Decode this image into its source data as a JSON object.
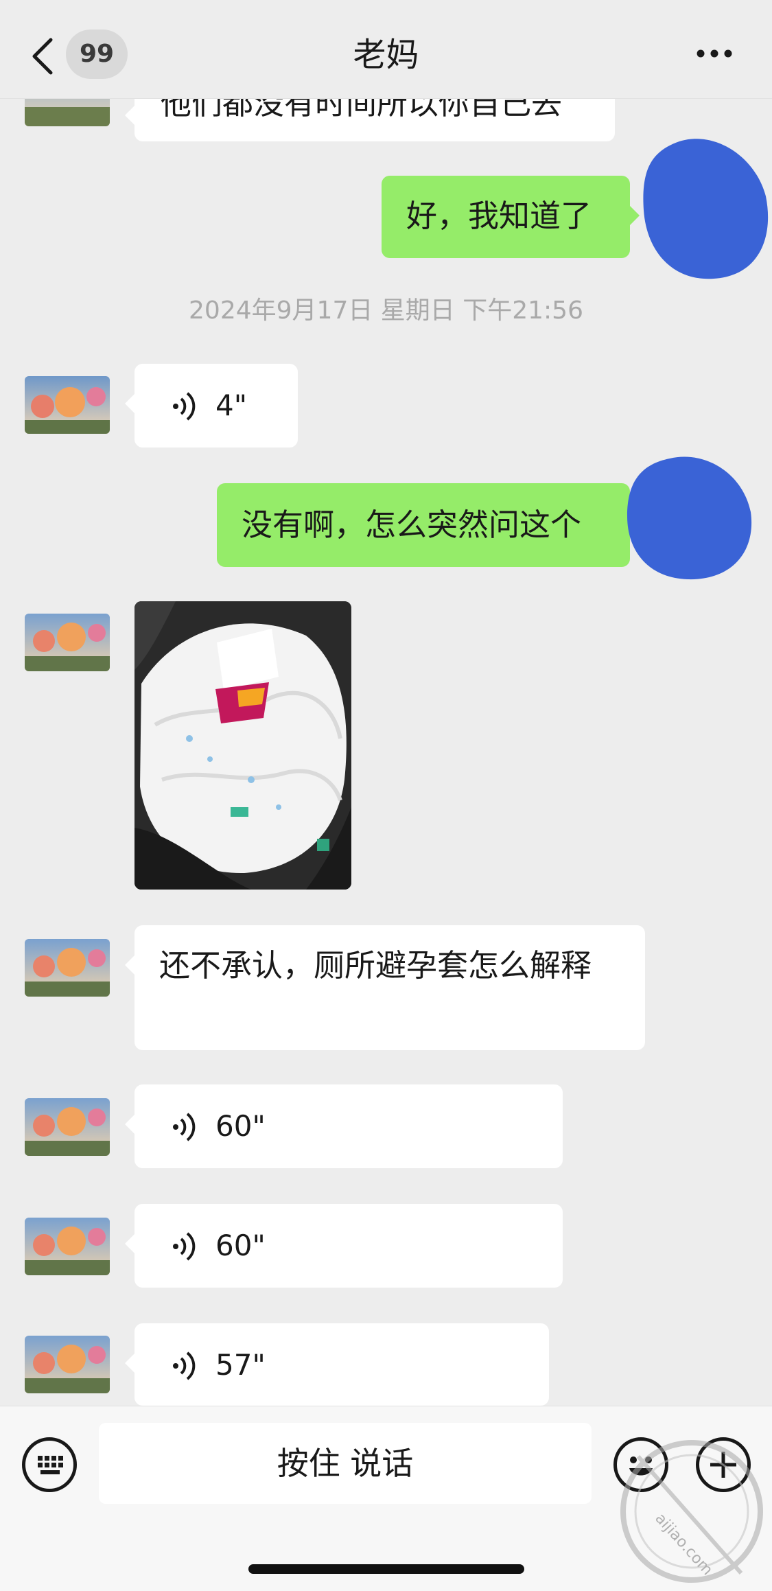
{
  "header": {
    "unread_count": "99",
    "title": "老妈"
  },
  "messages": {
    "m0_text": "他们都没有时间所以你自己去",
    "m1_text": "好，我知道了",
    "timestamp": "2024年9月17日 星期日 下午21:56",
    "m2_voice_duration": "4\"",
    "m3_text": "没有啊，怎么突然问这个",
    "m5_text": "还不承认，厕所避孕套怎么解释",
    "m6_voice_duration": "60\"",
    "m7_voice_duration": "60\"",
    "m8_voice_duration": "57\""
  },
  "input_bar": {
    "hold_to_talk_label": "按住 说话"
  },
  "watermark": {
    "text": "aijiao.com"
  },
  "colors": {
    "background": "#ededed",
    "sent_bubble": "#95ec69",
    "received_bubble": "#ffffff",
    "timestamp_text": "#a9a9a9",
    "scribble": "#3a63d6"
  },
  "icons": [
    "back-icon",
    "more-icon",
    "voice-icon",
    "keyboard-icon",
    "emoji-icon",
    "plus-icon"
  ]
}
